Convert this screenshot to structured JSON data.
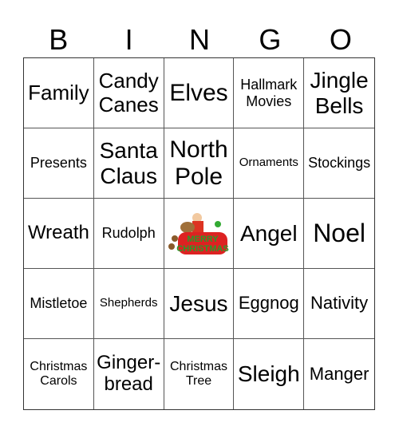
{
  "header": [
    "B",
    "I",
    "N",
    "G",
    "O"
  ],
  "cells": [
    {
      "text": "Family",
      "size": 26
    },
    {
      "text": "Candy\nCanes",
      "size": 26
    },
    {
      "text": "Elves",
      "size": 30
    },
    {
      "text": "Hallmark\nMovies",
      "size": 18
    },
    {
      "text": "Jingle\nBells",
      "size": 28
    },
    {
      "text": "Presents",
      "size": 18
    },
    {
      "text": "Santa\nClaus",
      "size": 28
    },
    {
      "text": "North\nPole",
      "size": 30
    },
    {
      "text": "Ornaments",
      "size": 15
    },
    {
      "text": "Stockings",
      "size": 18
    },
    {
      "text": "Wreath",
      "size": 24
    },
    {
      "text": "Rudolph",
      "size": 18
    },
    {
      "text": "",
      "size": 0,
      "free": true,
      "image": "merry-christmas-santa-image"
    },
    {
      "text": "Angel",
      "size": 28
    },
    {
      "text": "Noel",
      "size": 32
    },
    {
      "text": "Mistletoe",
      "size": 18
    },
    {
      "text": "Shepherds",
      "size": 15
    },
    {
      "text": "Jesus",
      "size": 28
    },
    {
      "text": "Eggnog",
      "size": 22
    },
    {
      "text": "Nativity",
      "size": 22
    },
    {
      "text": "Christmas\nCarols",
      "size": 16
    },
    {
      "text": "Ginger-\nbread",
      "size": 24
    },
    {
      "text": "Christmas\nTree",
      "size": 16
    },
    {
      "text": "Sleigh",
      "size": 28
    },
    {
      "text": "Manger",
      "size": 22
    }
  ]
}
